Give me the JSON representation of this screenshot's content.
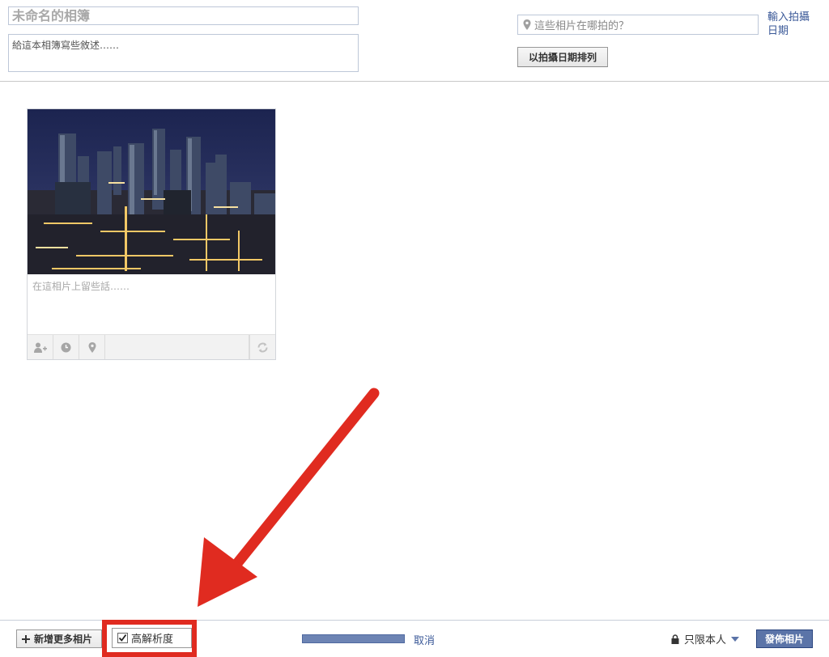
{
  "album": {
    "title_placeholder": "未命名的相簿",
    "description_placeholder": "給這本相簿寫些敘述……"
  },
  "location": {
    "placeholder": "這些相片在哪拍的？",
    "icon": "map-pin-icon"
  },
  "date_link": "輸入拍攝日期",
  "sort_button": "以拍攝日期排列",
  "photo": {
    "caption_placeholder": "在這相片上留些話……",
    "toolbar_icons": [
      "tag-person-icon",
      "clock-icon",
      "map-pin-icon",
      "rotate-icon"
    ]
  },
  "footer": {
    "add_more_label": "新增更多相片",
    "hires_label": "高解析度",
    "hires_checked": true,
    "cancel_label": "取消",
    "privacy_label": "只限本人",
    "publish_label": "發佈相片"
  },
  "colors": {
    "link": "#3b5998",
    "primary_button": "#5b74a8",
    "highlight": "#e02b20",
    "progress": "#6d84b4"
  }
}
